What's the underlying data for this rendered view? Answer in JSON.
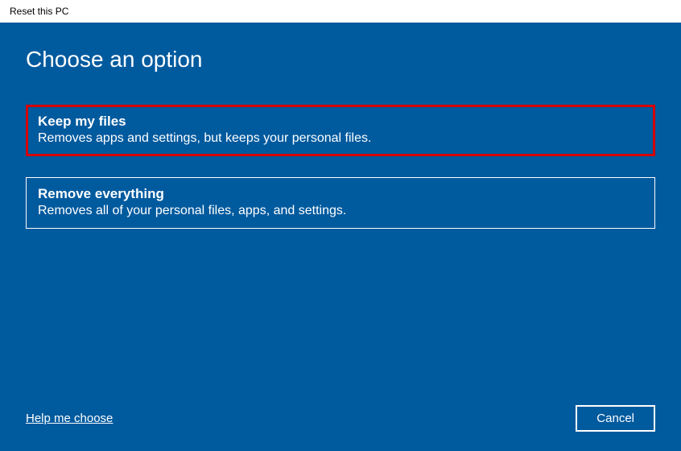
{
  "window": {
    "title": "Reset this PC"
  },
  "heading": "Choose an option",
  "options": [
    {
      "title": "Keep my files",
      "description": "Removes apps and settings, but keeps your personal files."
    },
    {
      "title": "Remove everything",
      "description": "Removes all of your personal files, apps, and settings."
    }
  ],
  "footer": {
    "help_link": "Help me choose",
    "cancel_label": "Cancel"
  }
}
